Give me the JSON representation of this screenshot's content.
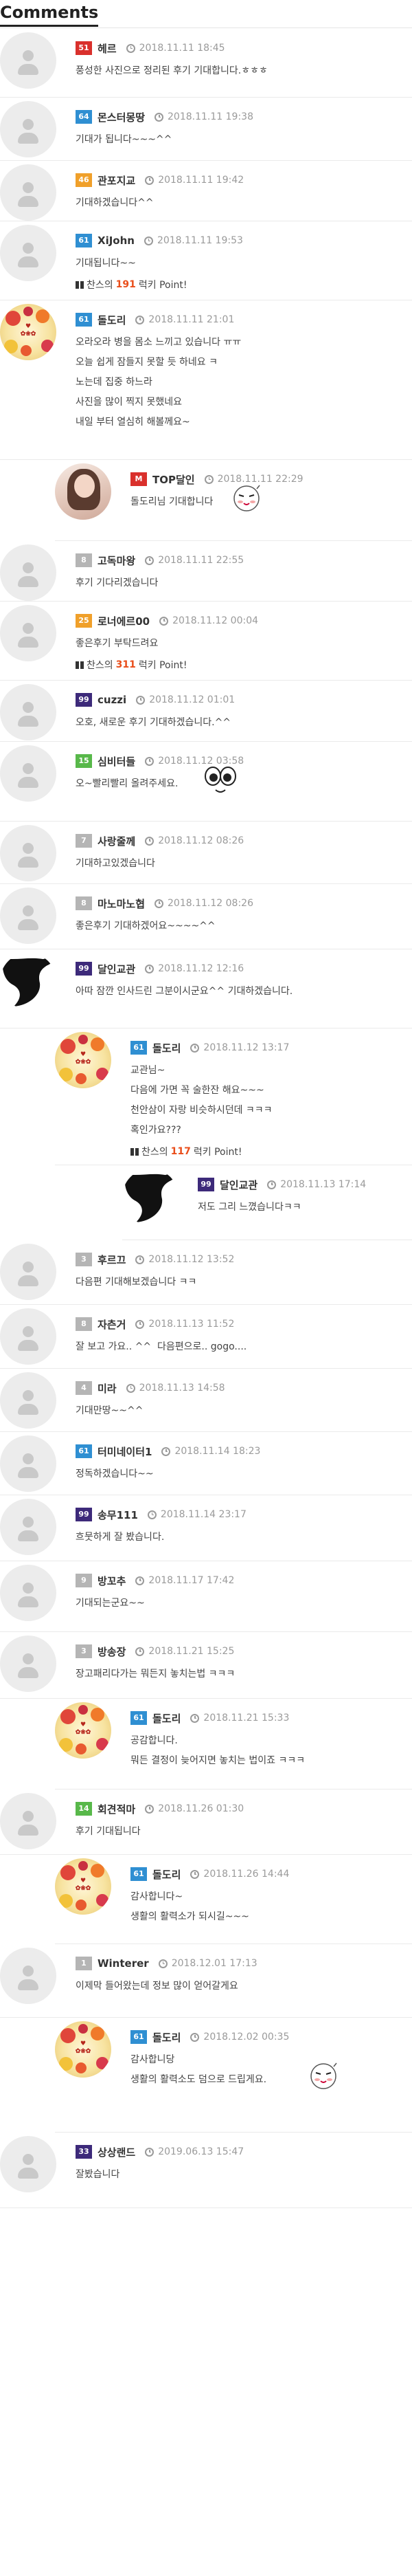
{
  "section_title": "Comments",
  "colors": {
    "level_red": "#d9302c",
    "level_blue": "#2f8fd2",
    "level_orange": "#f0a02a",
    "level_green": "#58b84a",
    "level_purple": "#3d2a7a",
    "level_gray": "#b5b5b5",
    "point_orange": "#e94e1b"
  },
  "comments": [
    {
      "level": "51",
      "level_color": "#d9302c",
      "name": "헤르",
      "date": "2018.11.11 18:45",
      "avatar": "generic",
      "lines": [
        "풍성한 사진으로 정리된 후기 기대합니다.ㅎㅎㅎ"
      ]
    },
    {
      "level": "64",
      "level_color": "#2f8fd2",
      "name": "몬스터몽땅",
      "date": "2018.11.11 19:38",
      "avatar": "generic",
      "lines": [
        "기대가 됩니다~~~^^"
      ]
    },
    {
      "level": "46",
      "level_color": "#f0a02a",
      "name": "관포지교",
      "date": "2018.11.11 19:42",
      "avatar": "generic",
      "lines": [
        "기대하겠습니다^^"
      ]
    },
    {
      "level": "61",
      "level_color": "#2f8fd2",
      "name": "XiJohn",
      "date": "2018.11.11 19:53",
      "avatar": "generic",
      "lines": [
        "기대됩니다~~"
      ],
      "point": {
        "prefix": "찬스의",
        "value": "191",
        "suffix": "럭키 Point!"
      }
    },
    {
      "level": "61",
      "level_color": "#2f8fd2",
      "name": "돌도리",
      "date": "2018.11.11 21:01",
      "avatar": "flower",
      "lines": [
        "오라오라 병을 몸소 느끼고 있습니다 ㅠㅠ",
        "오늘 쉽게 잠들지 못할 듯 하네요 ㅋ",
        "노는데 집중 하느라",
        "사진을 많이 찍지 못했네요",
        "내일 부터 열심히 해볼께요~"
      ]
    },
    {
      "level": "M",
      "level_color": "#d9302c",
      "name": "TOP달인",
      "date": "2018.11.11 22:29",
      "avatar": "photo",
      "reply": true,
      "lines": [
        "돌도리님 기대합니다"
      ],
      "emoji": "face"
    },
    {
      "level": "8",
      "level_color": "#b5b5b5",
      "name": "고독마왕",
      "date": "2018.11.11 22:55",
      "avatar": "generic",
      "lines": [
        "후기 기다리겠습니다"
      ]
    },
    {
      "level": "25",
      "level_color": "#f0a02a",
      "name": "로너에르00",
      "date": "2018.11.12 00:04",
      "avatar": "generic",
      "lines": [
        "좋은후기 부탁드려요"
      ],
      "point": {
        "prefix": "찬스의",
        "value": "311",
        "suffix": "럭키 Point!"
      }
    },
    {
      "level": "99",
      "level_color": "#3d2a7a",
      "name": "cuzzi",
      "date": "2018.11.12 01:01",
      "avatar": "generic",
      "lines": [
        "오호, 새로운 후기 기대하겠습니다.^^"
      ]
    },
    {
      "level": "15",
      "level_color": "#58b84a",
      "name": "심비터들",
      "date": "2018.11.12 03:58",
      "avatar": "generic",
      "lines": [
        "오~빨리빨리 올려주세요."
      ],
      "emoji": "eyes"
    },
    {
      "level": "7",
      "level_color": "#b5b5b5",
      "name": "사랑줄께",
      "date": "2018.11.12 08:26",
      "avatar": "generic",
      "lines": [
        "기대하고있겠습니다"
      ]
    },
    {
      "level": "8",
      "level_color": "#b5b5b5",
      "name": "마노마노협",
      "date": "2018.11.12 08:26",
      "avatar": "generic",
      "lines": [
        "좋은후기 기대하겠어요~~~~^^"
      ]
    },
    {
      "level": "99",
      "level_color": "#3d2a7a",
      "name": "달인교관",
      "date": "2018.11.12 12:16",
      "avatar": "bird",
      "lines": [
        "아따 잠깐 인사드린 그분이시군요^^ 기대하겠습니다."
      ]
    },
    {
      "level": "61",
      "level_color": "#2f8fd2",
      "name": "돌도리",
      "date": "2018.11.12 13:17",
      "avatar": "flower",
      "reply": true,
      "lines": [
        "교관님~",
        "다음에 가면 꼭 술한잔 해요~~~",
        "천안삼이 자랑 비슷하시던데 ㅋㅋㅋ",
        "혹인가요???"
      ],
      "point": {
        "prefix": "찬스의",
        "value": "117",
        "suffix": "럭키 Point!"
      }
    },
    {
      "level": "99",
      "level_color": "#3d2a7a",
      "name": "달인교관",
      "date": "2018.11.13 17:14",
      "avatar": "bird",
      "reply2": true,
      "lines": [
        "저도 그리 느꼈습니다ㅋㅋ"
      ]
    },
    {
      "level": "3",
      "level_color": "#b5b5b5",
      "name": "후르끄",
      "date": "2018.11.12 13:52",
      "avatar": "generic",
      "lines": [
        "다음편 기대해보겠습니다 ㅋㅋ"
      ]
    },
    {
      "level": "8",
      "level_color": "#b5b5b5",
      "name": "자츤거",
      "date": "2018.11.13 11:52",
      "avatar": "generic",
      "lines": [
        "잘 보고 가요.. ^^  다음편으로.. gogo...."
      ]
    },
    {
      "level": "4",
      "level_color": "#b5b5b5",
      "name": "미라",
      "date": "2018.11.13 14:58",
      "avatar": "generic",
      "lines": [
        "기대만땅~~^^"
      ]
    },
    {
      "level": "61",
      "level_color": "#2f8fd2",
      "name": "터미네이터1",
      "date": "2018.11.14 18:23",
      "avatar": "generic",
      "lines": [
        "정독하겠습니다~~"
      ]
    },
    {
      "level": "99",
      "level_color": "#3d2a7a",
      "name": "송무111",
      "date": "2018.11.14 23:17",
      "avatar": "generic",
      "lines": [
        "흐뭇하게 잘 봤습니다."
      ]
    },
    {
      "level": "9",
      "level_color": "#b5b5b5",
      "name": "방꼬추",
      "date": "2018.11.17 17:42",
      "avatar": "generic",
      "lines": [
        "기대되는군요~~"
      ]
    },
    {
      "level": "3",
      "level_color": "#b5b5b5",
      "name": "방송장",
      "date": "2018.11.21 15:25",
      "avatar": "generic",
      "lines": [
        "장고패리다가는 뭐든지 놓치는법 ㅋㅋㅋ"
      ]
    },
    {
      "level": "61",
      "level_color": "#2f8fd2",
      "name": "돌도리",
      "date": "2018.11.21 15:33",
      "avatar": "flower",
      "reply": true,
      "lines": [
        "공감합니다.",
        "뭐든 결정이 늦어지면 놓치는 법이죠 ㅋㅋㅋ"
      ]
    },
    {
      "level": "14",
      "level_color": "#58b84a",
      "name": "회견적마",
      "date": "2018.11.26 01:30",
      "avatar": "generic",
      "lines": [
        "후기 기대됩니다"
      ]
    },
    {
      "level": "61",
      "level_color": "#2f8fd2",
      "name": "돌도리",
      "date": "2018.11.26 14:44",
      "avatar": "flower",
      "reply": true,
      "lines": [
        "감사합니다~",
        "생활의 활력소가 되시길~~~"
      ]
    },
    {
      "level": "1",
      "level_color": "#b5b5b5",
      "name": "Winterer",
      "date": "2018.12.01 17:13",
      "avatar": "generic",
      "lines": [
        "이제막 들어왔는데 정보 많이 얻어갈게요"
      ]
    },
    {
      "level": "61",
      "level_color": "#2f8fd2",
      "name": "돌도리",
      "date": "2018.12.02 00:35",
      "avatar": "flower",
      "reply": true,
      "lines": [
        "감사합니당",
        "생활의 활력소도 덤으로 드립게요."
      ],
      "emoji": "face"
    },
    {
      "level": "33",
      "level_color": "#3d2a7a",
      "name": "상상랜드",
      "date": "2019.06.13 15:47",
      "avatar": "generic",
      "lines": [
        "잘봤습니다"
      ]
    }
  ]
}
